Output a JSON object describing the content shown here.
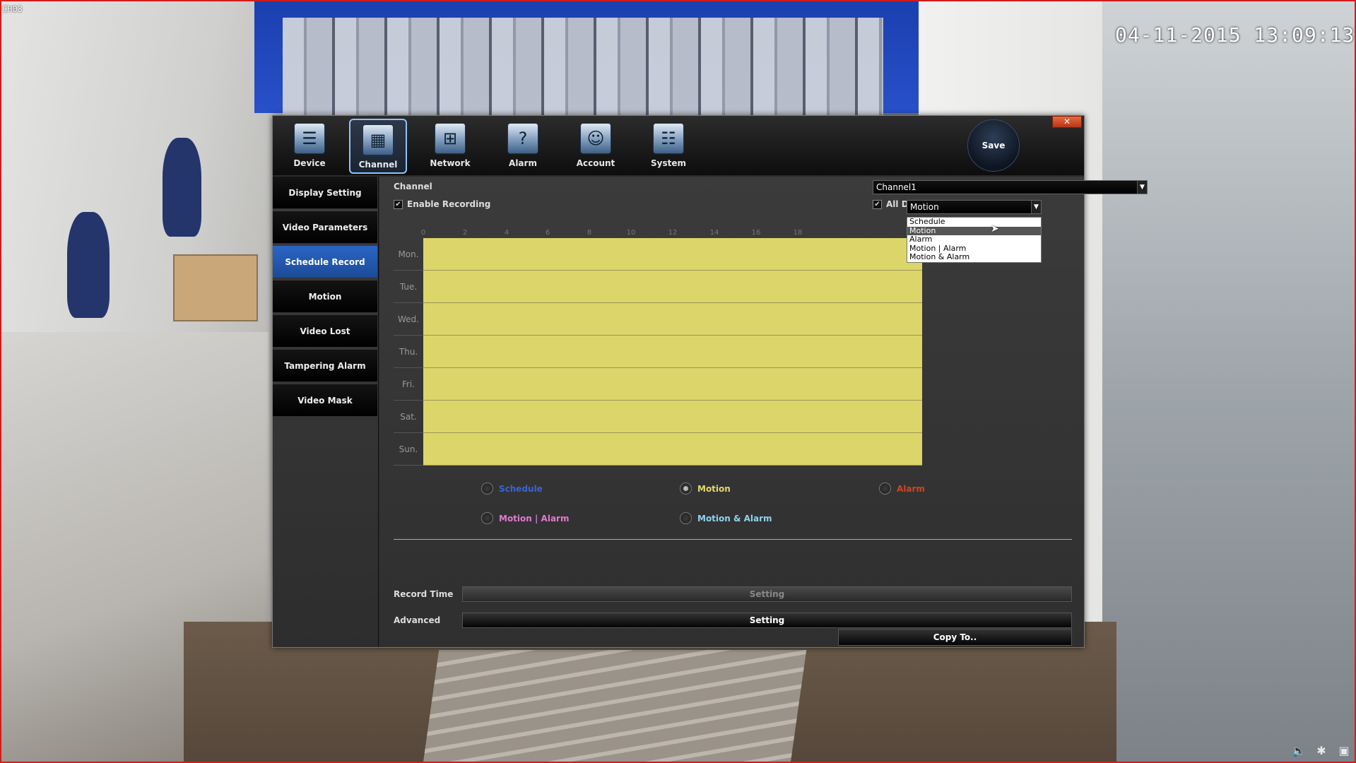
{
  "osd": {
    "channel_label": "CH03",
    "timestamp": "04-11-2015 13:09:13",
    "frame_color": "#d21c1c"
  },
  "toolbar": {
    "items": [
      {
        "label": "Device",
        "icon": "device-icon"
      },
      {
        "label": "Channel",
        "icon": "channel-icon"
      },
      {
        "label": "Network",
        "icon": "network-icon"
      },
      {
        "label": "Alarm",
        "icon": "alarm-icon"
      },
      {
        "label": "Account",
        "icon": "account-icon"
      },
      {
        "label": "System",
        "icon": "system-icon"
      }
    ],
    "active": "Channel",
    "save_label": "Save",
    "close_label": "✕"
  },
  "sidebar": {
    "items": [
      {
        "label": "Display Setting"
      },
      {
        "label": "Video Parameters"
      },
      {
        "label": "Schedule Record"
      },
      {
        "label": "Motion"
      },
      {
        "label": "Video Lost"
      },
      {
        "label": "Tampering Alarm"
      },
      {
        "label": "Video Mask"
      }
    ],
    "active": "Schedule Record",
    "active_color": "#2a65c4"
  },
  "form": {
    "channel_label": "Channel",
    "channel_value": "Channel1",
    "enable_recording_label": "Enable Recording",
    "enable_recording_checked": true,
    "all_day_label": "All Day Recording",
    "all_day_checked": true,
    "mode_value": "Motion",
    "mode_options": [
      "Schedule",
      "Motion",
      "Alarm",
      "Motion | Alarm",
      "Motion & Alarm"
    ]
  },
  "schedule": {
    "hour_ticks": [
      "0",
      "2",
      "4",
      "6",
      "8",
      "10",
      "12",
      "14",
      "16",
      "18"
    ],
    "days": [
      "Mon.",
      "Tue.",
      "Wed.",
      "Thu.",
      "Fri.",
      "Sat.",
      "Sun."
    ],
    "fill_color": "#dcd56a"
  },
  "legend": {
    "items": [
      {
        "label": "Schedule",
        "color": "#3a63d8",
        "selected": false
      },
      {
        "label": "Motion",
        "color": "#e6d86a",
        "selected": true
      },
      {
        "label": "Alarm",
        "color": "#d2451e",
        "selected": false
      },
      {
        "label": "Motion | Alarm",
        "color": "#e07ad0",
        "selected": false
      },
      {
        "label": "Motion & Alarm",
        "color": "#8fd2f0",
        "selected": false
      }
    ]
  },
  "bottom": {
    "record_time_label": "Record Time",
    "record_time_button": "Setting",
    "advanced_label": "Advanced",
    "advanced_button": "Setting",
    "copy_button": "Copy To.."
  }
}
